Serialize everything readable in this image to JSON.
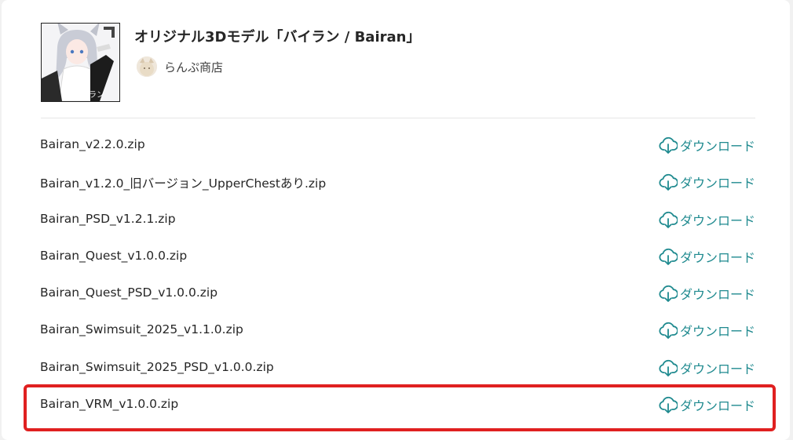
{
  "product": {
    "title": "オリジナル3Dモデル「バイラン / Bairan」",
    "thumbnail_caption": "バイラン",
    "shop_name": "らんぷ商店"
  },
  "download_label": "ダウンロード",
  "files": [
    {
      "name": "Bairan_v2.2.0.zip"
    },
    {
      "name": "Bairan_v1.2.0_旧バージョン_UpperChestあり.zip"
    },
    {
      "name": "Bairan_PSD_v1.2.1.zip"
    },
    {
      "name": "Bairan_Quest_v1.0.0.zip"
    },
    {
      "name": "Bairan_Quest_PSD_v1.0.0.zip"
    },
    {
      "name": "Bairan_Swimsuit_2025_v1.1.0.zip"
    },
    {
      "name": "Bairan_Swimsuit_2025_PSD_v1.0.0.zip"
    },
    {
      "name": "Bairan_VRM_v1.0.0.zip"
    }
  ],
  "highlighted_file_index": 7,
  "colors": {
    "accent": "#1f8a8f",
    "highlight": "#e02020"
  },
  "icons": {
    "download": "cloud-download-icon"
  }
}
